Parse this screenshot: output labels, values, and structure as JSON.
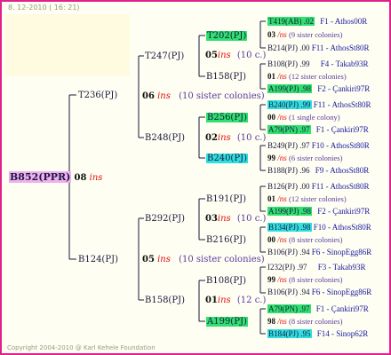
{
  "header": "8. 12-2010 ( 16: 21)",
  "footer": "Copyright 2004-2010 @ Karl Kehele Foundation",
  "root": {
    "code": "B852(PPR)",
    "gen": "08",
    "ins": "ins"
  },
  "gen1": [
    {
      "code": "T236(PJ)",
      "gen": "06",
      "ins": "ins",
      "sister": "(10 sister colonies)"
    },
    {
      "code": "B124(PJ)",
      "gen": "05",
      "ins": "ins",
      "sister": "(10 sister colonies)"
    }
  ],
  "gen2": [
    {
      "code": "T247(PJ)",
      "gen": "05",
      "ins": "ins",
      "count": "(10 c.)"
    },
    {
      "code": "B248(PJ)",
      "gen": "02",
      "ins": "ins",
      "count": "(10 c.)"
    },
    {
      "code": "B292(PJ)",
      "gen": "03",
      "ins": "ins",
      "count": "(10 c.)"
    },
    {
      "code": "B158(PJ)",
      "gen": "01",
      "ins": "ins",
      "count": "(12 c.)"
    }
  ],
  "gen3": [
    {
      "code": "T202(PJ)"
    },
    {
      "code": "B158(PJ)"
    },
    {
      "code": "B256(PJ)"
    },
    {
      "code": "B240(PJ)"
    },
    {
      "code": "B191(PJ)"
    },
    {
      "code": "B216(PJ)"
    },
    {
      "code": "B108(PJ)"
    },
    {
      "code": "A199(PJ)"
    }
  ],
  "gen4": [
    {
      "top": "T419(AB) .02",
      "top_src": "F1 - Athos00R",
      "mid": "03",
      "ins": "/ns",
      "sister": "(9 sister colonies)",
      "bot": "B214(PJ) .00",
      "bot_src": "F11 - AthosSt80R"
    },
    {
      "top": "B108(PJ) .99",
      "top_src": "F4 - Takab93R",
      "mid": "01",
      "ins": "/ns",
      "sister": "(12 sister colonies)",
      "bot": "A199(PJ) .98",
      "bot_src": "F2 - Çankiri97R"
    },
    {
      "top": "B240(PJ) .99",
      "top_src": "F11 - AthosSt80R",
      "mid": "00",
      "ins": "/ns",
      "sister": "(1 single colony)",
      "bot": "A79(PN) .97",
      "bot_src": "F1 - Çankiri97R"
    },
    {
      "top": "B249(PJ) .97",
      "top_src": "F10 - AthosSt80R",
      "mid": "99",
      "ins": "/ns",
      "sister": "(6 sister colonies)",
      "bot": "B188(PJ) .96",
      "bot_src": "F9 - AthosSt80R"
    },
    {
      "top": "B126(PJ) .00",
      "top_src": "F11 - AthosSt80R",
      "mid": "01",
      "ins": "/ns",
      "sister": "(12 sister colonies)",
      "bot": "A199(PJ) .98",
      "bot_src": "F2 - Çankiri97R"
    },
    {
      "top": "B134(PJ) .98",
      "top_src": "F10 - AthosSt80R",
      "mid": "00",
      "ins": "/ns",
      "sister": "(8 sister colonies)",
      "bot": "B106(PJ) .94",
      "bot_src": "F6 - SinopEgg86R"
    },
    {
      "top": "I232(PJ) .97",
      "top_src": "F3 - Takab93R",
      "mid": "99",
      "ins": "/ns",
      "sister": "(8 sister colonies)",
      "bot": "B106(PJ) .94",
      "bot_src": "F6 - SinopEgg86R"
    },
    {
      "top": "A79(PN) .97",
      "top_src": "F1 - Çankiri97R",
      "mid": "98",
      "ins": "/ns",
      "sister": "(8 sister colonies)",
      "bot": "B184(PJ) .95",
      "bot_src": "F14 - Sinop62R"
    }
  ],
  "colors": {
    "border": "#e0208c",
    "green": "#30e070",
    "cyan": "#30e0e0",
    "pink": "#f0b0f0",
    "ins": "#e01010",
    "source": "#1818a0"
  }
}
